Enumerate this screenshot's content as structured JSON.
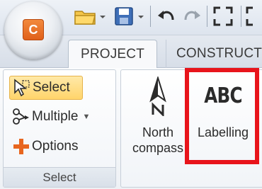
{
  "app": {
    "logo_letter": "C",
    "logo_color": "#e8661f"
  },
  "quick_access": {
    "icons": [
      "open-folder-icon",
      "save-icon",
      "undo-icon",
      "redo-icon",
      "fullscreen-icon"
    ]
  },
  "tabs": [
    {
      "label": "PROJECT",
      "active": true
    },
    {
      "label": "CONSTRUCT",
      "active": false
    }
  ],
  "select_group": {
    "label": "Select",
    "buttons": {
      "select": "Select",
      "multiple": "Multiple",
      "options": "Options"
    }
  },
  "nav_group": {
    "north_compass": {
      "line1": "North",
      "line2": "compass"
    },
    "labelling": {
      "icon_text": "ABC",
      "label": "Labelling"
    }
  },
  "colors": {
    "highlight": "#e8141b",
    "selected_button": "#ffd46b",
    "accent_orange": "#e8661f"
  }
}
